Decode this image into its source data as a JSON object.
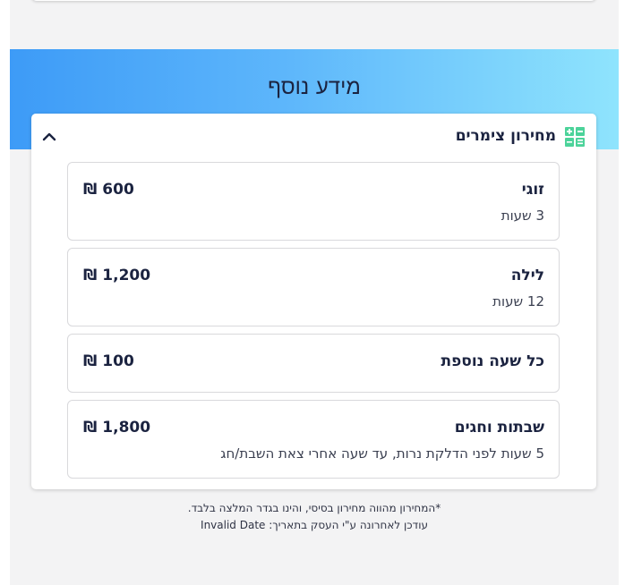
{
  "section": {
    "title": "מידע נוסף"
  },
  "panel": {
    "title": "מחירון צימרים",
    "icon": "grid-calculator-icon",
    "toggle_icon": "chevron-up-icon",
    "accent_color": "#4cd39a"
  },
  "price_items": [
    {
      "name": "זוגי",
      "duration": "3 שעות",
      "price": "600 ₪"
    },
    {
      "name": "לילה",
      "duration": "12 שעות",
      "price": "1,200 ₪"
    },
    {
      "name": "כל שעה נוספת",
      "duration": "",
      "price": "100 ₪"
    },
    {
      "name": "שבתות וחגים",
      "duration": "5 שעות לפני הדלקת נרות, עד שעה אחרי צאת השבת/חג",
      "price": "1,800 ₪"
    }
  ],
  "footnotes": {
    "disclaimer": "*המחירון מהווה מחירון בסיסי, והינו בגדר המלצה בלבד.",
    "updated": "עודכן לאחרונה ע\"י העסק בתאריך: Invalid Date"
  },
  "colors": {
    "hero_gradient_start": "#3d9bf7",
    "hero_gradient_end": "#8fe4fd",
    "text_dark": "#1b2340"
  }
}
